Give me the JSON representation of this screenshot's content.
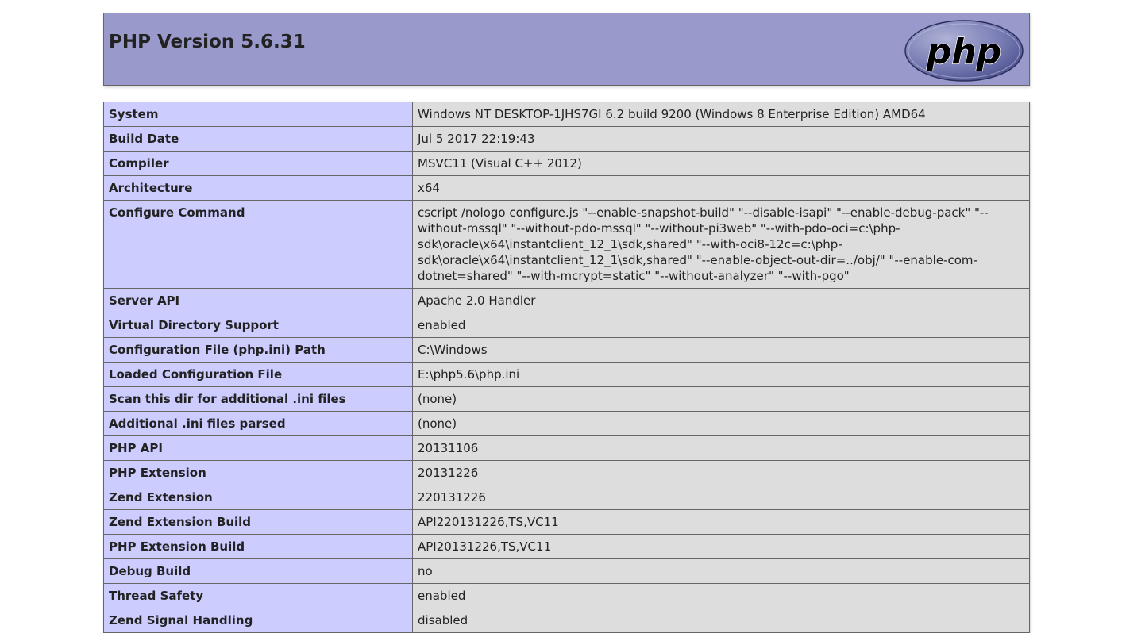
{
  "header": {
    "title": "PHP Version 5.6.31",
    "logo_text": "php",
    "colors": {
      "header_bg": "#9999cc",
      "label_bg": "#ccccff",
      "value_bg": "#dddddd",
      "logo_bg": "#777bb3"
    }
  },
  "rows": [
    {
      "label": "System",
      "value": "Windows NT DESKTOP-1JHS7GI 6.2 build 9200 (Windows 8 Enterprise Edition) AMD64"
    },
    {
      "label": "Build Date",
      "value": "Jul 5 2017 22:19:43"
    },
    {
      "label": "Compiler",
      "value": "MSVC11 (Visual C++ 2012)"
    },
    {
      "label": "Architecture",
      "value": "x64"
    },
    {
      "label": "Configure Command",
      "value": "cscript /nologo configure.js \"--enable-snapshot-build\" \"--disable-isapi\" \"--enable-debug-pack\" \"--without-mssql\" \"--without-pdo-mssql\" \"--without-pi3web\" \"--with-pdo-oci=c:\\php-sdk\\oracle\\x64\\instantclient_12_1\\sdk,shared\" \"--with-oci8-12c=c:\\php-sdk\\oracle\\x64\\instantclient_12_1\\sdk,shared\" \"--enable-object-out-dir=../obj/\" \"--enable-com-dotnet=shared\" \"--with-mcrypt=static\" \"--without-analyzer\" \"--with-pgo\""
    },
    {
      "label": "Server API",
      "value": "Apache 2.0 Handler"
    },
    {
      "label": "Virtual Directory Support",
      "value": "enabled"
    },
    {
      "label": "Configuration File (php.ini) Path",
      "value": "C:\\Windows"
    },
    {
      "label": "Loaded Configuration File",
      "value": "E:\\php5.6\\php.ini"
    },
    {
      "label": "Scan this dir for additional .ini files",
      "value": "(none)"
    },
    {
      "label": "Additional .ini files parsed",
      "value": "(none)"
    },
    {
      "label": "PHP API",
      "value": "20131106"
    },
    {
      "label": "PHP Extension",
      "value": "20131226"
    },
    {
      "label": "Zend Extension",
      "value": "220131226"
    },
    {
      "label": "Zend Extension Build",
      "value": "API220131226,TS,VC11"
    },
    {
      "label": "PHP Extension Build",
      "value": "API20131226,TS,VC11"
    },
    {
      "label": "Debug Build",
      "value": "no"
    },
    {
      "label": "Thread Safety",
      "value": "enabled"
    },
    {
      "label": "Zend Signal Handling",
      "value": "disabled"
    }
  ]
}
